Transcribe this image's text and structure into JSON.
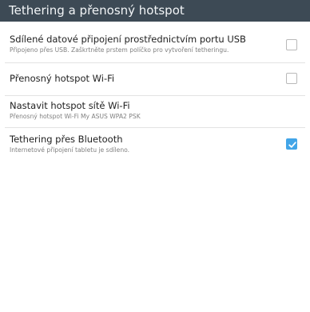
{
  "header": {
    "title": "Tethering a přenosný hotspot"
  },
  "settings": [
    {
      "title": "Sdílené datové připojení prostřednictvím portu USB",
      "summary": "Připojeno přes USB. Zaškrtněte prstem políčko pro vytvoření tetheringu.",
      "checked": false
    },
    {
      "title": "Přenosný hotspot Wi-Fi",
      "checked": false
    },
    {
      "title": "Nastavit hotspot sítě Wi-Fi",
      "summary": "Přenosný hotspot Wi-Fi My ASUS WPA2 PSK"
    },
    {
      "title": "Tethering přes Bluetooth",
      "summary": "Internetové připojení tabletu je sdíleno.",
      "checked": true
    }
  ],
  "colors": {
    "actionbar": "#3d4a55",
    "accent": "#42a5e8",
    "divider": "#e3e3e3"
  }
}
